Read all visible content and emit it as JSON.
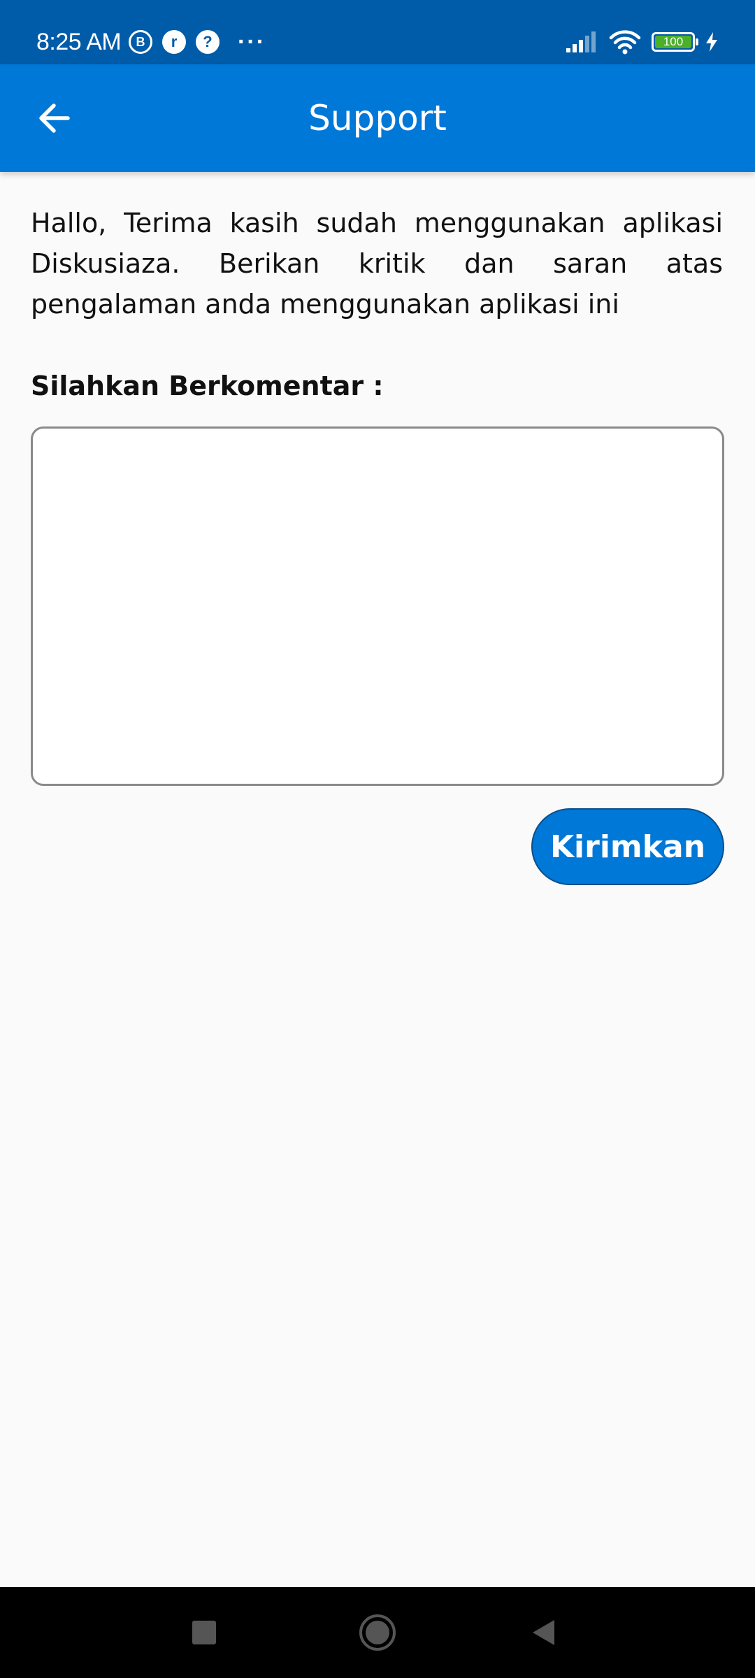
{
  "status_bar": {
    "time": "8:25 AM",
    "icons": [
      "b-circle-icon",
      "r-circle-icon",
      "help-circle-icon",
      "more-dots-icon"
    ],
    "battery": "100",
    "battery_level": 1.0,
    "colors": {
      "background": "#005ca8",
      "battery_fill": "#4caf2a"
    }
  },
  "app_bar": {
    "title": "Support",
    "back_icon": "arrow-left-icon",
    "color": "#0078d8"
  },
  "content": {
    "intro": "Hallo, Terima kasih sudah menggunakan aplikasi Diskusiaza. Berikan kritik dan saran atas pengalaman anda menggunakan aplikasi ini",
    "comment_label": "Silahkan Berkomentar :",
    "comment_value": "",
    "submit_label": "Kirimkan"
  },
  "nav_bar": {
    "buttons": [
      "recents-square-icon",
      "home-circle-icon",
      "back-triangle-icon"
    ]
  }
}
